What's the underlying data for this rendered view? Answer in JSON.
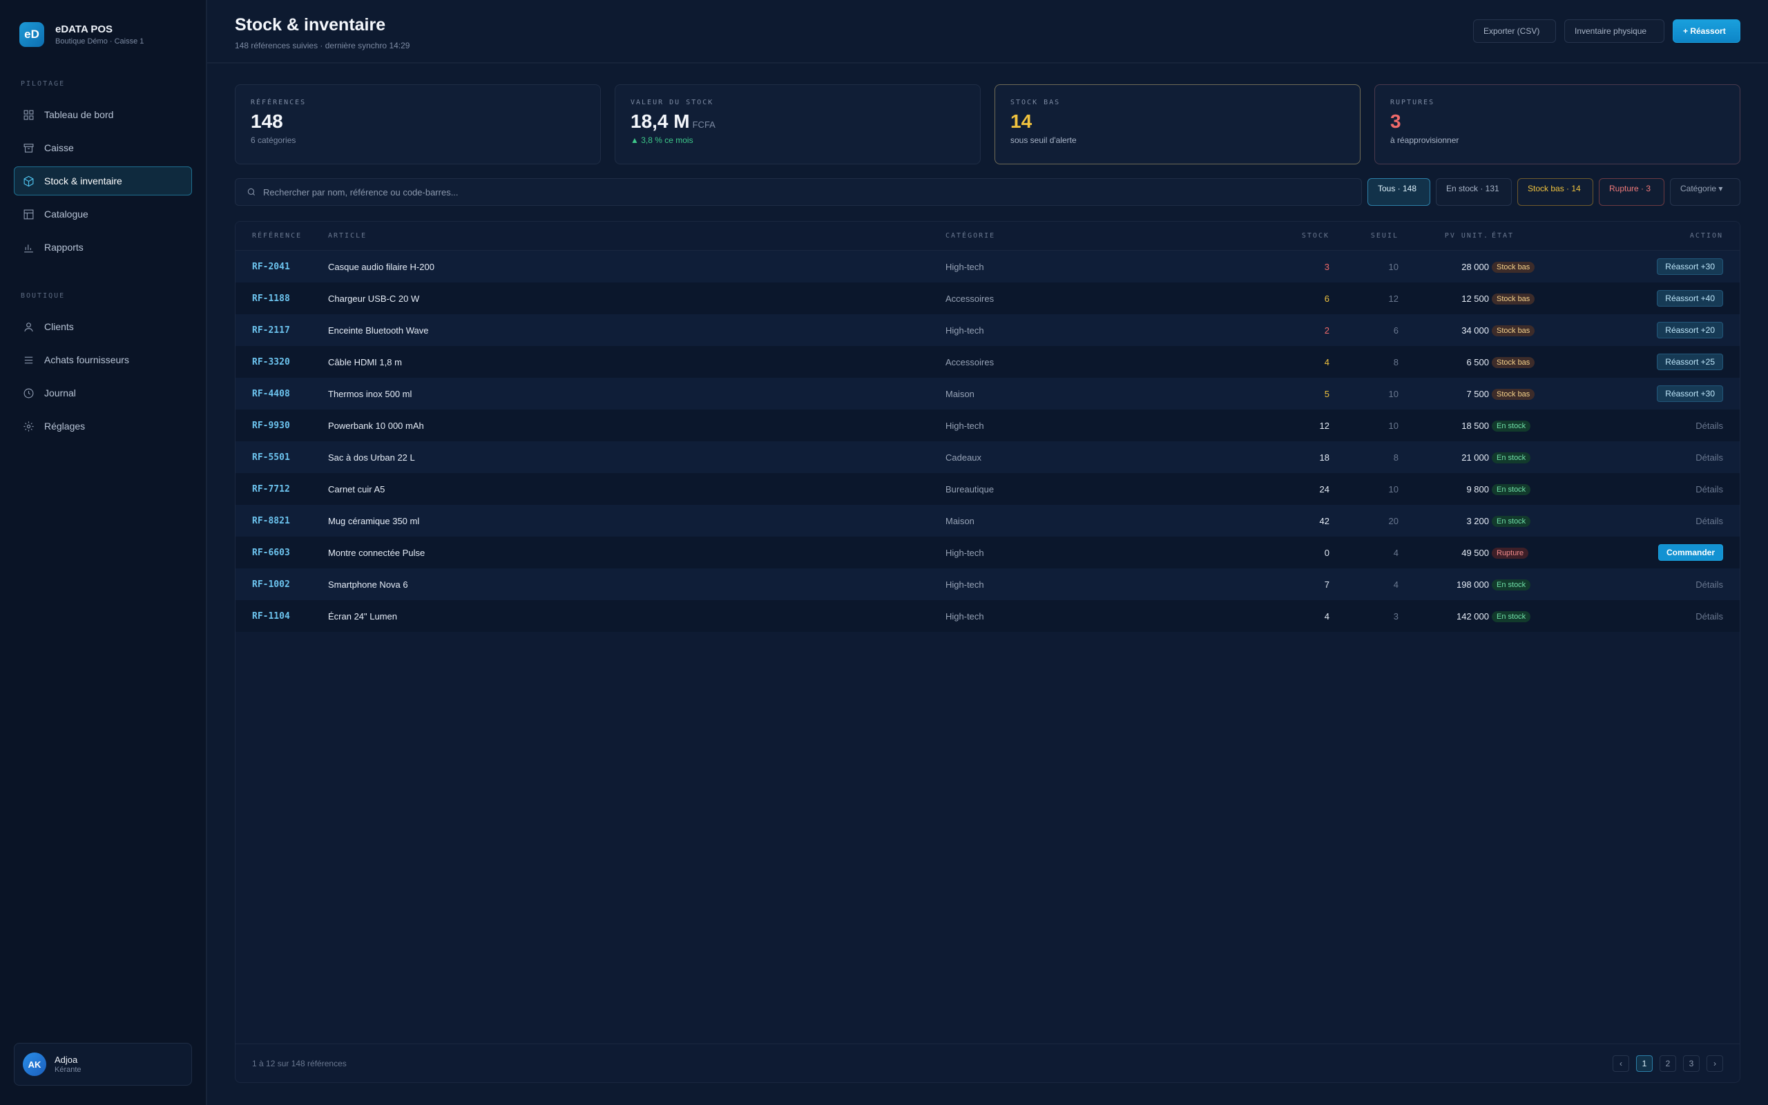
{
  "brand": {
    "logo": "eD",
    "name": "eDATA POS",
    "subtitle": "Boutique Démo · Caisse 1"
  },
  "sidebar": {
    "section_pilotage": "PILOTAGE",
    "section_boutique": "BOUTIQUE",
    "items": [
      {
        "label": "Tableau de bord",
        "icon": "grid-icon"
      },
      {
        "label": "Caisse",
        "icon": "register-icon"
      },
      {
        "label": "Stock & inventaire",
        "icon": "box-icon",
        "active": true
      },
      {
        "label": "Catalogue",
        "icon": "catalog-icon"
      },
      {
        "label": "Rapports",
        "icon": "bar-chart-icon"
      }
    ],
    "items2": [
      {
        "label": "Clients",
        "icon": "user-icon"
      },
      {
        "label": "Achats fournisseurs",
        "icon": "list-icon"
      },
      {
        "label": "Journal",
        "icon": "clock-icon"
      },
      {
        "label": "Réglages",
        "icon": "gear-icon"
      }
    ]
  },
  "user": {
    "initials": "AK",
    "name": "Adjoa",
    "name2": "K",
    "role": "érante"
  },
  "header": {
    "title": "Stock & inventaire",
    "subtitle": "148 références suivies · dernière synchro 14:29",
    "btn_export": "Exporter (CSV)",
    "btn_inventaire": "Inventaire physique",
    "btn_reassort": "+ Réassort"
  },
  "kpis": [
    {
      "label": "RÉFÉRENCES",
      "value": "148",
      "unit": "",
      "sub": "6 catégories"
    },
    {
      "label": "VALEUR DU STOCK",
      "value": "18,4 M",
      "unit": "FCFA",
      "sub": "▲ 3,8 % ce mois"
    },
    {
      "label": "STOCK BAS",
      "value": "14",
      "unit": "",
      "sub": "sous seuil d'alerte"
    },
    {
      "label": "RUPTURES",
      "value": "3",
      "unit": "",
      "sub": "à réapprovisionner"
    }
  ],
  "search": {
    "placeholder": "Rechercher par nom, référence ou code-barres..."
  },
  "filters": {
    "all": "Tous · 148",
    "instock": "En stock · 131",
    "low": "Stock bas · 14",
    "out": "Rupture · 3",
    "category": "Catégorie ▾"
  },
  "table": {
    "columns": {
      "ref": "RÉFÉRENCE",
      "article": "ARTICLE",
      "category": "CATÉGORIE",
      "stock": "STOCK",
      "seuil": "SEUIL",
      "pv": "PV UNIT.",
      "etat": "ÉTAT",
      "action": "ACTION"
    },
    "rows": [
      {
        "ref": "RF-2041",
        "article": "Casque audio filaire H-200",
        "category": "High-tech",
        "stock": "3",
        "seuil": "10",
        "pv": "28 000",
        "etat": "Stock bas",
        "status": "low",
        "stock_level": "red",
        "action": "Réassort +30",
        "action_type": "btn"
      },
      {
        "ref": "RF-1188",
        "article": "Chargeur USB-C 20 W",
        "category": "Accessoires",
        "stock": "6",
        "seuil": "12",
        "pv": "12 500",
        "etat": "Stock bas",
        "status": "low",
        "stock_level": "yellow",
        "action": "Réassort +40",
        "action_type": "btn"
      },
      {
        "ref": "RF-2117",
        "article": "Enceinte Bluetooth Wave",
        "category": "High-tech",
        "stock": "2",
        "seuil": "6",
        "pv": "34 000",
        "etat": "Stock bas",
        "status": "low",
        "stock_level": "red",
        "action": "Réassort +20",
        "action_type": "btn"
      },
      {
        "ref": "RF-3320",
        "article": "Câble HDMI 1,8 m",
        "category": "Accessoires",
        "stock": "4",
        "seuil": "8",
        "pv": "6 500",
        "etat": "Stock bas",
        "status": "low",
        "stock_level": "yellow",
        "action": "Réassort +25",
        "action_type": "btn"
      },
      {
        "ref": "RF-4408",
        "article": "Thermos inox 500 ml",
        "category": "Maison",
        "stock": "5",
        "seuil": "10",
        "pv": "7 500",
        "etat": "Stock bas",
        "status": "low",
        "stock_level": "yellow",
        "action": "Réassort +30",
        "action_type": "btn"
      },
      {
        "ref": "RF-9930",
        "article": "Powerbank 10 000 mAh",
        "category": "High-tech",
        "stock": "12",
        "seuil": "10",
        "pv": "18 500",
        "etat": "En stock",
        "status": "ok",
        "stock_level": "normal",
        "action": "Détails",
        "action_type": "link"
      },
      {
        "ref": "RF-5501",
        "article": "Sac à dos Urban 22 L",
        "category": "Cadeaux",
        "stock": "18",
        "seuil": "8",
        "pv": "21 000",
        "etat": "En stock",
        "status": "ok",
        "stock_level": "normal",
        "action": "Détails",
        "action_type": "link"
      },
      {
        "ref": "RF-7712",
        "article": "Carnet cuir A5",
        "category": "Bureautique",
        "stock": "24",
        "seuil": "10",
        "pv": "9 800",
        "etat": "En stock",
        "status": "ok",
        "stock_level": "normal",
        "action": "Détails",
        "action_type": "link"
      },
      {
        "ref": "RF-8821",
        "article": "Mug céramique 350 ml",
        "category": "Maison",
        "stock": "42",
        "seuil": "20",
        "pv": "3 200",
        "etat": "En stock",
        "status": "ok",
        "stock_level": "normal",
        "action": "Détails",
        "action_type": "link"
      },
      {
        "ref": "RF-6603",
        "article": "Montre connectée Pulse",
        "category": "High-tech",
        "stock": "0",
        "seuil": "4",
        "pv": "49 500",
        "etat": "Rupture",
        "status": "out",
        "stock_level": "normal",
        "action": "Commander",
        "action_type": "primary"
      },
      {
        "ref": "RF-1002",
        "article": "Smartphone Nova 6",
        "category": "High-tech",
        "stock": "7",
        "seuil": "4",
        "pv": "198 000",
        "etat": "En stock",
        "status": "ok",
        "stock_level": "normal",
        "action": "Détails",
        "action_type": "link"
      },
      {
        "ref": "RF-1104",
        "article": "Écran 24\" Lumen",
        "category": "High-tech",
        "stock": "4",
        "seuil": "3",
        "pv": "142 000",
        "etat": "En stock",
        "status": "ok",
        "stock_level": "normal",
        "action": "Détails",
        "action_type": "link"
      }
    ]
  },
  "footer": {
    "summary": "1 à 12 sur 148 références",
    "prev": "‹",
    "next": "›",
    "pages": [
      "1",
      "2",
      "3"
    ],
    "current_page": "1"
  },
  "colors": {
    "accent": "#1aa0dd",
    "warning": "#f0c23e",
    "danger": "#f06a6a",
    "success": "#3ec98a",
    "background": "#0d1a30",
    "sidebar": "#0a1426"
  }
}
